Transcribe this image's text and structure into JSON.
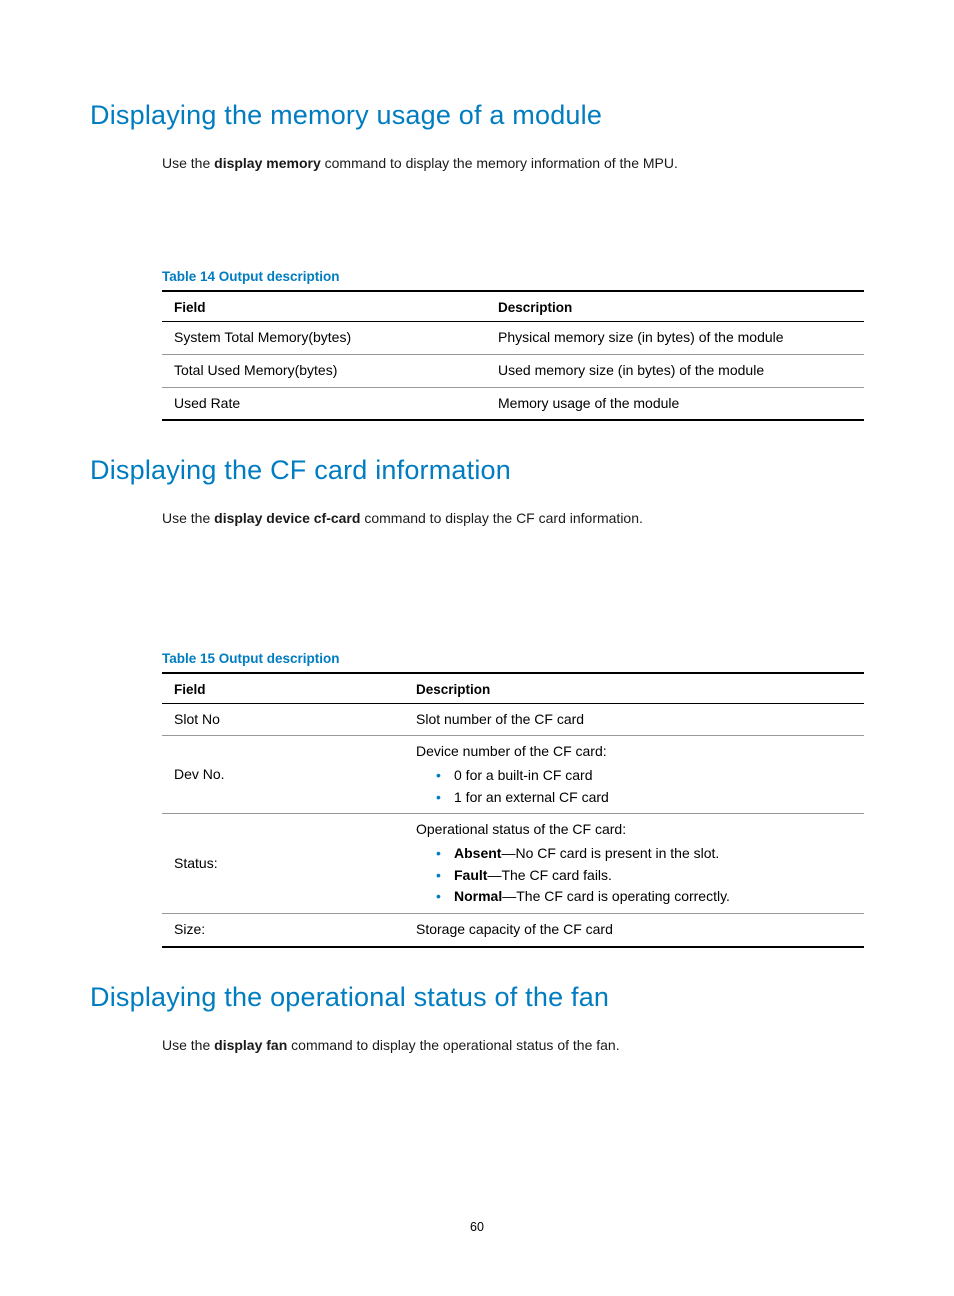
{
  "section1": {
    "heading": "Displaying the memory usage of a module",
    "intro_prefix": "Use the ",
    "intro_cmd": "display memory",
    "intro_suffix": " command to display the memory information of the MPU.",
    "table_caption": "Table 14 Output description",
    "th_field": "Field",
    "th_desc": "Description",
    "rows": [
      {
        "field": "System Total Memory(bytes)",
        "desc": "Physical memory size (in bytes) of the module"
      },
      {
        "field": "Total Used Memory(bytes)",
        "desc": "Used memory size (in bytes) of the module"
      },
      {
        "field": "Used Rate",
        "desc": "Memory usage of the module"
      }
    ]
  },
  "section2": {
    "heading": "Displaying the CF card information",
    "intro_prefix": "Use the ",
    "intro_cmd": "display device cf-card",
    "intro_suffix": " command to display the CF card information.",
    "table_caption": "Table 15 Output description",
    "th_field": "Field",
    "th_desc": "Description",
    "rows": {
      "r0": {
        "field": "Slot No",
        "desc": "Slot number of the CF card"
      },
      "r1": {
        "field": "Dev No.",
        "lead": "Device number of the CF card:",
        "b0": "0 for a built-in CF card",
        "b1": "1 for an external CF card"
      },
      "r2": {
        "field": "Status:",
        "lead": "Operational status of the CF card:",
        "b0k": "Absent",
        "b0v": "—No CF card is present in the slot.",
        "b1k": "Fault",
        "b1v": "—The CF card fails.",
        "b2k": "Normal",
        "b2v": "—The CF card is operating correctly."
      },
      "r3": {
        "field": "Size:",
        "desc": "Storage capacity of the CF card"
      }
    }
  },
  "section3": {
    "heading": "Displaying the operational status of the fan",
    "intro_prefix": "Use the ",
    "intro_cmd": "display fan",
    "intro_suffix": " command to display the operational status of the fan."
  },
  "page_number": "60"
}
